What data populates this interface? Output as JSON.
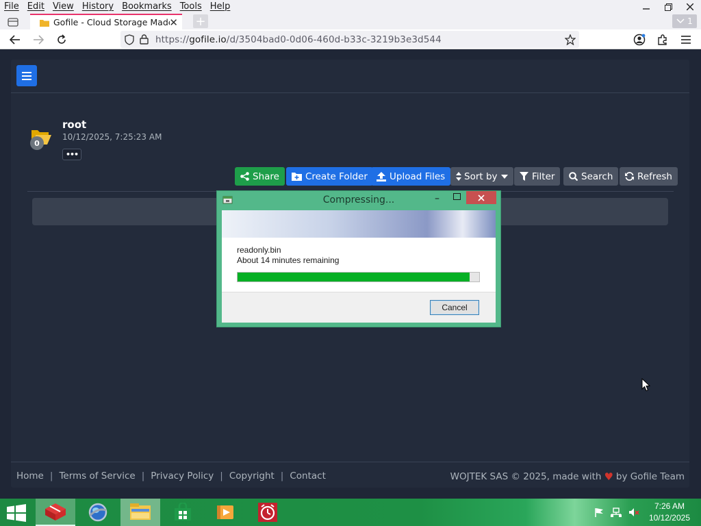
{
  "browser": {
    "menu": [
      "File",
      "Edit",
      "View",
      "History",
      "Bookmarks",
      "Tools",
      "Help"
    ],
    "tab_title": "Gofile - Cloud Storage Made Sir",
    "tab_count": "1",
    "url_prefix": "https://",
    "url_domain": "gofile.io",
    "url_path": "/d/3504bad0-0d06-460d-b33c-3219b3e3d544"
  },
  "folder": {
    "badge": "0",
    "name": "root",
    "date": "10/12/2025, 7:25:23 AM",
    "more": "•••"
  },
  "actions": {
    "share": "Share",
    "create_folder": "Create Folder",
    "upload_files": "Upload Files",
    "sort_by": "Sort by",
    "filter": "Filter",
    "search": "Search",
    "refresh": "Refresh"
  },
  "dialog": {
    "title": "Compressing...",
    "file": "readonly.bin",
    "remaining": "About 14 minutes remaining",
    "progress_fraction": 0.96,
    "cancel": "Cancel"
  },
  "footer": {
    "links": [
      "Home",
      "Terms of Service",
      "Privacy Policy",
      "Copyright",
      "Contact"
    ],
    "copyright_prefix": "WOJTEK SAS © 2025, made with",
    "copyright_suffix": "by Gofile Team"
  },
  "taskbar": {
    "time": "7:26 AM",
    "date": "10/12/2025"
  },
  "colors": {
    "page_bg": "#1f2636",
    "accent_blue": "#1f6fe5",
    "share_green": "#1e9e4a",
    "dialog_frame": "#53b88a",
    "progress_green": "#06b025"
  }
}
